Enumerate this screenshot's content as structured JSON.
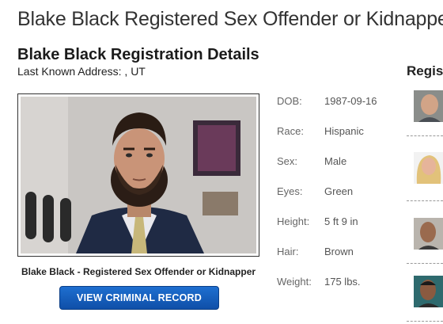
{
  "page_title": "Blake Black Registered Sex Offender or Kidnapper",
  "details_heading": "Blake Black Registration Details",
  "address": "Last Known Address: , UT",
  "photo_caption": "Blake Black - Registered Sex Offender or Kidnapper",
  "record_button_label": "VIEW CRIMINAL RECORD",
  "details": [
    {
      "label": "DOB:",
      "value": "1987-09-16"
    },
    {
      "label": "Race:",
      "value": "Hispanic"
    },
    {
      "label": "Sex:",
      "value": "Male"
    },
    {
      "label": "Eyes:",
      "value": "Green"
    },
    {
      "label": "Height:",
      "value": "5 ft 9 in"
    },
    {
      "label": "Hair:",
      "value": "Brown"
    },
    {
      "label": "Weight:",
      "value": "175 lbs."
    }
  ],
  "sidebar_title": "Regis",
  "colors": {
    "button": "#1b5fbd",
    "title": "#333333"
  }
}
